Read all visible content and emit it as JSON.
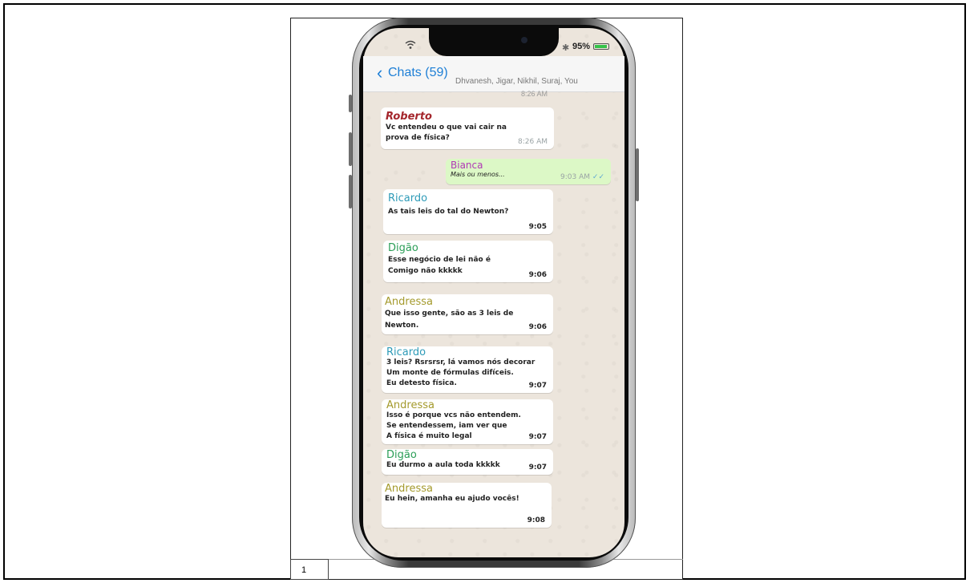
{
  "page": {
    "page_number": "1"
  },
  "status": {
    "battery": "95%"
  },
  "nav": {
    "back_label": "Chats (59)",
    "participants": "Dhvanesh, Jigar, Nikhil, Suraj, You",
    "cut_time": "8:26 AM"
  },
  "colors": {
    "ios_blue": "#1e7fd6",
    "chat_bg": "#ece5dc",
    "sent_bubble": "#dcf8c6"
  },
  "messages": [
    {
      "sender": "Roberto",
      "sender_color": "#a4262c",
      "text": "Vc entendeu o que vai cair na\nprova de física?",
      "time": "8:26 AM"
    },
    {
      "sender": "Bianca",
      "sender_color": "#b038b5",
      "text": "Mais ou menos...",
      "time": "9:03 AM",
      "sent": true,
      "ticks": "✓✓"
    },
    {
      "sender": "Ricardo",
      "sender_color": "#2e9bb8",
      "text": "As tais leis do tal do Newton?",
      "time": "9:05"
    },
    {
      "sender": "Digão",
      "sender_color": "#2b9e57",
      "text": "Esse negócio de lei não é\nComigo não kkkkk",
      "time": "9:06"
    },
    {
      "sender": "Andressa",
      "sender_color": "#a49a2c",
      "text": "Que isso gente, são as 3 leis de\nNewton.",
      "time": "9:06"
    },
    {
      "sender": "Ricardo",
      "sender_color": "#2e9bb8",
      "text": "3 leis? Rsrsrsr, lá vamos nós decorar\nUm monte de fórmulas difíceis.\nEu detesto física.",
      "time": "9:07"
    },
    {
      "sender": "Andressa",
      "sender_color": "#a49a2c",
      "text": "Isso é porque vcs não entendem.\nSe entendessem, iam ver que\nA física é muito legal",
      "time": "9:07"
    },
    {
      "sender": "Digão",
      "sender_color": "#2b9e57",
      "text": "Eu durmo a aula toda kkkkk",
      "time": "9:07"
    },
    {
      "sender": "Andressa",
      "sender_color": "#a49a2c",
      "text": "Eu hein, amanha eu ajudo vocês!",
      "time": "9:08"
    }
  ]
}
